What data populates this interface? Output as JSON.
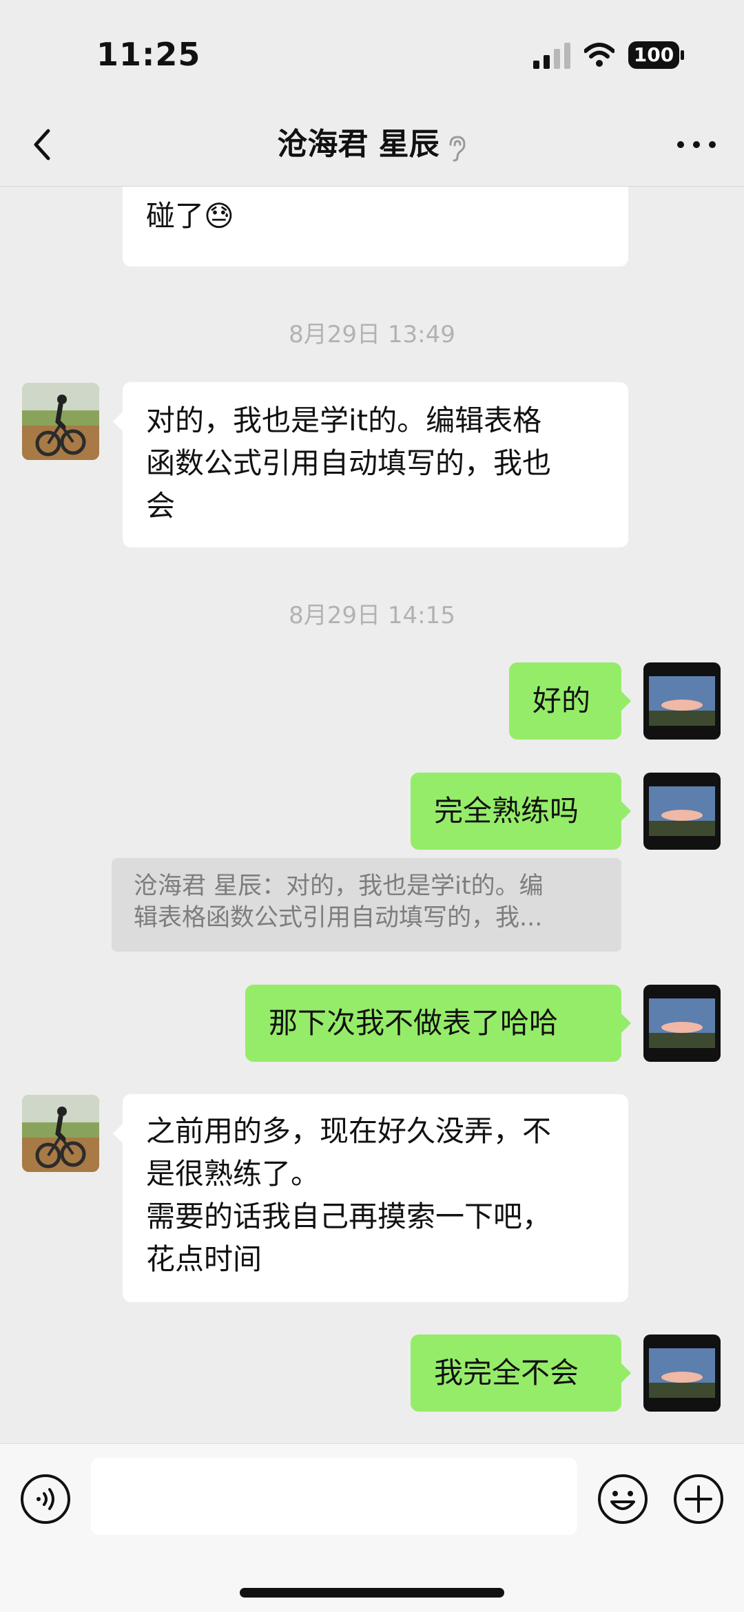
{
  "status_bar": {
    "time": "11:25",
    "battery": "100"
  },
  "nav": {
    "title": "沧海君 星辰"
  },
  "messages": {
    "m0": {
      "text": "碰了😓"
    },
    "ts1": "8月29日 13:49",
    "m1": {
      "line1": "对的，我也是学it的。编辑表格",
      "line2": "函数公式引用自动填写的，我也",
      "line3": "会"
    },
    "ts2": "8月29日 14:15",
    "m2": {
      "text": "好的"
    },
    "m3": {
      "text": "完全熟练吗"
    },
    "quote": {
      "line1": "沧海君 星辰：对的，我也是学it的。编",
      "line2": "辑表格函数公式引用自动填写的，我..."
    },
    "m4": {
      "text": "那下次我不做表了哈哈"
    },
    "m5": {
      "line1": "之前用的多，现在好久没弄，不",
      "line2": "是很熟练了。",
      "line3": "需要的话我自己再摸索一下吧，",
      "line4": "花点时间"
    },
    "m6": {
      "text": "我完全不会"
    }
  },
  "input": {
    "value": ""
  },
  "colors": {
    "outgoing_bubble": "#95ec69",
    "incoming_bubble": "#ffffff",
    "background": "#ededed"
  }
}
